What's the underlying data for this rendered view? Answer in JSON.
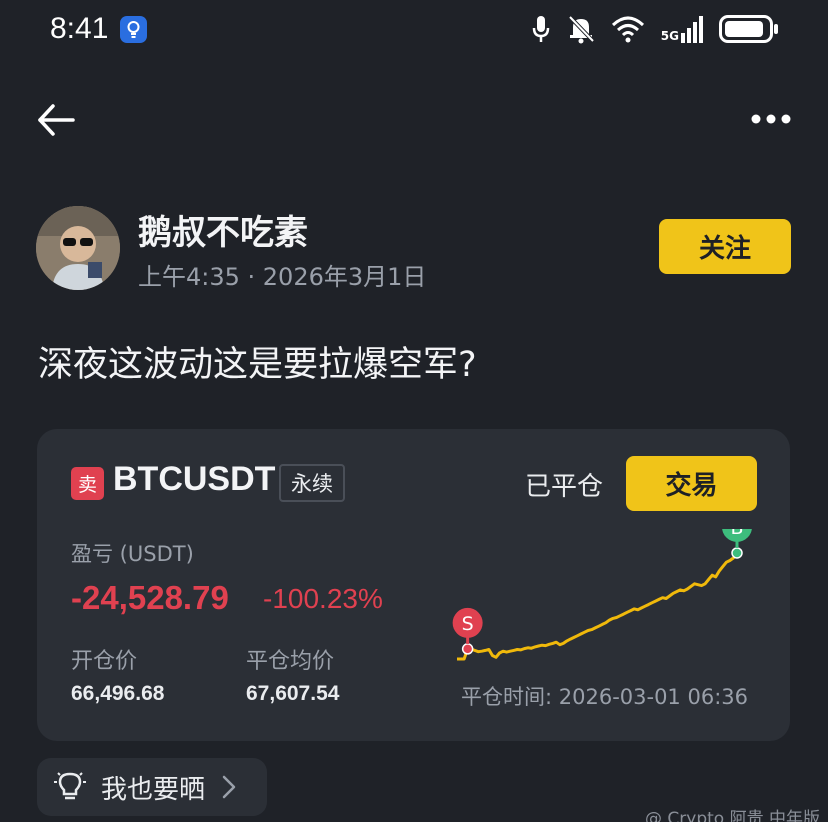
{
  "status_bar": {
    "time": "8:41",
    "network": "5G",
    "icons": [
      "lightbulb-app-icon",
      "microphone-icon",
      "bell-off-icon",
      "wifi-icon",
      "signal-icon",
      "battery-icon"
    ],
    "battery_level": 0.9
  },
  "nav": {
    "back_icon": "arrow-left-icon",
    "more_icon": "more-dots-icon"
  },
  "author": {
    "name": "鹅叔不吃素",
    "time": "上午4:35 · 2026年3月1日",
    "follow_label": "关注"
  },
  "post": {
    "text": "深夜这波动这是要拉爆空军?"
  },
  "trade": {
    "side_label": "卖",
    "symbol": "BTCUSDT",
    "contract_type": "永续",
    "status": "已平仓",
    "trade_button": "交易",
    "pnl_label": "盈亏 (USDT)",
    "pnl_value": "-24,528.79",
    "pnl_percent": "-100.23%",
    "entry_price_label": "开仓价",
    "entry_price": "66,496.68",
    "avg_close_label": "平仓均价",
    "avg_close_price": "67,607.54",
    "close_time": "平仓时间: 2026-03-01 06:36",
    "sell_marker": "S",
    "buy_marker": "B"
  },
  "chart_data": {
    "type": "line",
    "series": [
      {
        "values": [
          66380,
          66380,
          66380,
          66496,
          66496,
          66480,
          66465,
          66470,
          66480,
          66490,
          66420,
          66400,
          66450,
          66470,
          66460,
          66470,
          66480,
          66490,
          66485,
          66500,
          66510,
          66505,
          66520,
          66530,
          66540,
          66535,
          66550,
          66560,
          66575,
          66545,
          66560,
          66590,
          66610,
          66630,
          66650,
          66670,
          66690,
          66710,
          66720,
          66740,
          66760,
          66780,
          66800,
          66830,
          66850,
          66860,
          66880,
          66900,
          66920,
          66940,
          66960,
          66950,
          66970,
          66990,
          67010,
          67030,
          67050,
          67070,
          67090,
          67080,
          67110,
          67140,
          67160,
          67180,
          67170,
          67190,
          67220,
          67250,
          67240,
          67230,
          67250,
          67300,
          67350,
          67330,
          67400,
          67450,
          67500,
          67520,
          67550,
          67607
        ]
      }
    ],
    "markers": [
      {
        "label": "S",
        "value": 66496.68,
        "index": 3,
        "color": "#e04150"
      },
      {
        "label": "B",
        "value": 67607.54,
        "index": 79,
        "color": "#3dbd7d"
      }
    ],
    "line_color": "#f0b90b",
    "grid": false
  },
  "share": {
    "label": "我也要晒",
    "icon": "lightbulb-icon"
  },
  "watermark": "@ Crypto 阿贵 中年版",
  "colors": {
    "accent": "#f0c419",
    "negative": "#e04150",
    "positive": "#3dbd7d",
    "background": "#1f2228",
    "card": "#2b2f36"
  }
}
